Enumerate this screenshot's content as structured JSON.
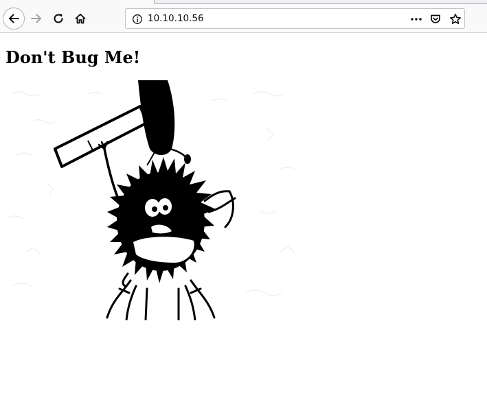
{
  "browser": {
    "url": "10.10.10.56",
    "icons": {
      "back": "arrow-left-icon",
      "forward": "arrow-right-icon",
      "reload": "reload-icon",
      "home": "home-icon",
      "site_info": "info-icon",
      "page_actions": "ellipsis-icon",
      "pocket": "pocket-icon",
      "bookmark": "star-icon"
    }
  },
  "page": {
    "heading": "Don't Bug Me!",
    "image_alt": "bug"
  }
}
